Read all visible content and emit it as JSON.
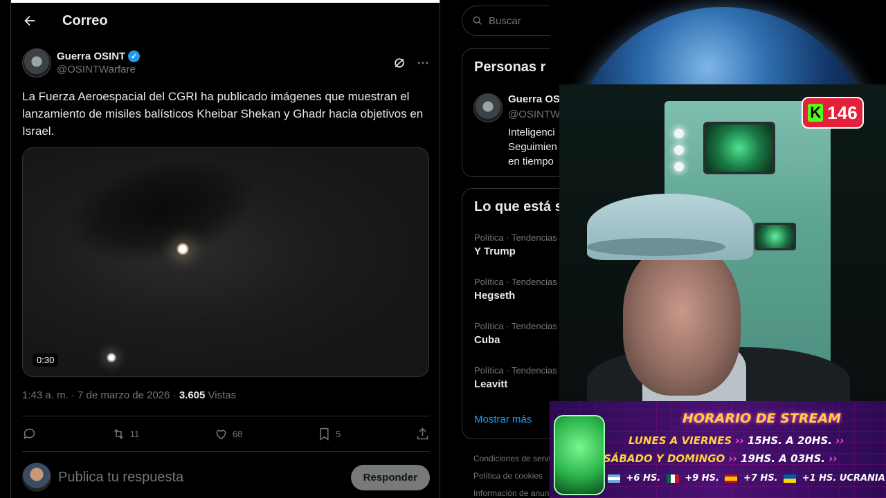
{
  "header": {
    "back_icon": "arrow-left-icon",
    "title": "Correo"
  },
  "tweet": {
    "author_name": "Guerra OSINT",
    "author_handle": "@OSINTWarfare",
    "text": "La Fuerza Aeroespacial del CGRI ha publicado imágenes que muestran el lanzamiento de misiles balísticos Kheibar Shekan y Ghadr hacia objetivos en Israel.",
    "video_duration": "0:30",
    "time": "1:43 a. m.",
    "date": "7 de marzo de 2026",
    "views_count": "3.605",
    "views_label": "Vistas",
    "separator": "·",
    "retweets": "11",
    "likes": "68",
    "bookmarks": "5"
  },
  "reply": {
    "placeholder": "Publica tu respuesta",
    "button": "Responder"
  },
  "sidebar": {
    "search_placeholder": "Buscar",
    "people_title": "Personas r",
    "person": {
      "name": "Guerra OS",
      "handle": "@OSINTW",
      "bio": [
        "Inteligenci",
        "Seguimien",
        "en tiempo"
      ]
    },
    "trends_title": "Lo que está s",
    "trends": [
      {
        "category": "Política · Tendencias",
        "name": "Y Trump"
      },
      {
        "category": "Política · Tendencias",
        "name": "Hegseth"
      },
      {
        "category": "Política · Tendencias",
        "name": "Cuba"
      },
      {
        "category": "Política · Tendencias",
        "name": "Leavitt"
      }
    ],
    "more": "Mostrar más",
    "footer": [
      "Condiciones de servi",
      "Política de cookies",
      "Información de anunc"
    ]
  },
  "stream": {
    "viewer_count": "146",
    "platform_letter": "K",
    "banner_title": "HORARIO DE STREAM",
    "row1_days": "LUNES A VIERNES",
    "row1_start": "15HS.",
    "row1_a": "A",
    "row1_end": "20HS.",
    "row2_days": "SÁBADO Y DOMINGO",
    "row2_start": "19HS.",
    "row2_a": "A",
    "row2_end": "03HS.",
    "timezones": [
      "+6 HS.",
      "+9 HS.",
      "+7 HS.",
      "+1 HS. UCRANIA"
    ]
  }
}
